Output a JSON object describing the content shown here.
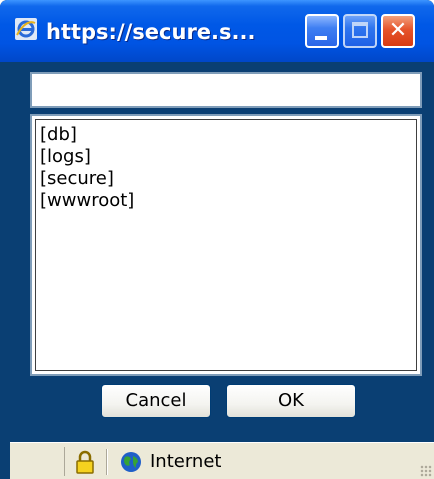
{
  "window": {
    "title": "https://secure.s...",
    "icons": {
      "app": "internet-explorer-icon",
      "minimize": "minimize-icon",
      "maximize": "maximize-icon",
      "close": "close-icon"
    },
    "close_glyph": "✕",
    "colors": {
      "frame": "#0a3f73",
      "titlebar": "#0054e3",
      "close_button": "#e6542b"
    }
  },
  "path_input": {
    "value": "",
    "placeholder": ""
  },
  "folder_list": {
    "items": [
      {
        "label": "[db]"
      },
      {
        "label": "[logs]"
      },
      {
        "label": "[secure]"
      },
      {
        "label": "[wwwroot]"
      }
    ]
  },
  "buttons": {
    "cancel_label": "Cancel",
    "ok_label": "OK"
  },
  "statusbar": {
    "zone_label": "Internet",
    "icons": {
      "lock": "lock-icon",
      "zone": "globe-icon",
      "grip": "resize-grip-icon"
    }
  }
}
